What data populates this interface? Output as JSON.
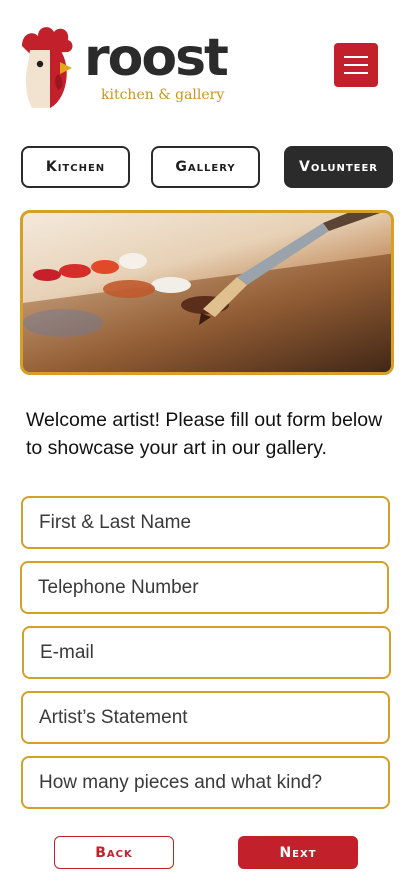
{
  "brand": {
    "name": "roost",
    "tagline": "kitchen & gallery",
    "logo_icon": "rooster-icon",
    "colors": {
      "red": "#c2202b",
      "gold": "#d4a025",
      "dark": "#2b2b2b"
    }
  },
  "header": {
    "menu_icon": "hamburger-menu-icon"
  },
  "tabs": [
    {
      "label": "Kitchen",
      "active": false
    },
    {
      "label": "Gallery",
      "active": false
    },
    {
      "label": "Volunteer",
      "active": true
    }
  ],
  "hero": {
    "image": "paint-palette-and-brush"
  },
  "intro": "Welcome artist! Please fill out form below to showcase your art in our gallery.",
  "form": {
    "fields": [
      {
        "placeholder": "First & Last Name",
        "value": ""
      },
      {
        "placeholder": "Telephone Number",
        "value": ""
      },
      {
        "placeholder": "E-mail",
        "value": ""
      },
      {
        "placeholder": "Artist’s Statement",
        "value": ""
      },
      {
        "placeholder": "How many pieces and what kind?",
        "value": ""
      }
    ]
  },
  "actions": {
    "back_label": "Back",
    "next_label": "Next"
  }
}
